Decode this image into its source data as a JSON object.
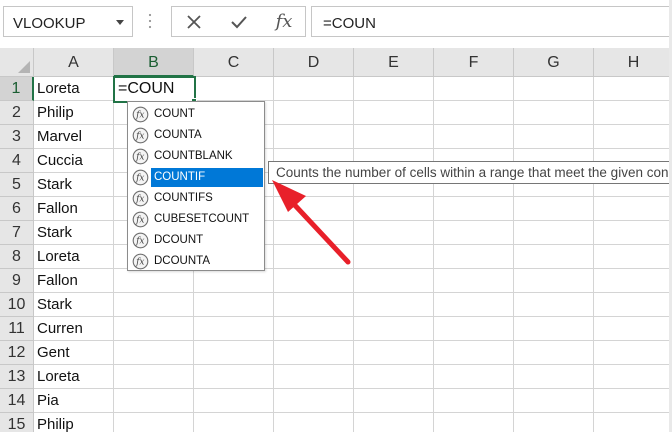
{
  "name_box": {
    "value": "VLOOKUP"
  },
  "formula_bar": {
    "cancel_icon": "x-icon",
    "enter_icon": "check-icon",
    "fx_label": "fx",
    "value": "=COUN"
  },
  "columns": [
    "A",
    "B",
    "C",
    "D",
    "E",
    "F",
    "G",
    "H"
  ],
  "active_column": "B",
  "active_row": "1",
  "rows": [
    {
      "num": "1",
      "a": "Loreta"
    },
    {
      "num": "2",
      "a": "Philip"
    },
    {
      "num": "3",
      "a": "Marvel"
    },
    {
      "num": "4",
      "a": "Cuccia"
    },
    {
      "num": "5",
      "a": "Stark"
    },
    {
      "num": "6",
      "a": "Fallon"
    },
    {
      "num": "7",
      "a": "Stark"
    },
    {
      "num": "8",
      "a": "Loreta"
    },
    {
      "num": "9",
      "a": "Fallon"
    },
    {
      "num": "10",
      "a": "Stark"
    },
    {
      "num": "11",
      "a": "Curren"
    },
    {
      "num": "12",
      "a": "Gent"
    },
    {
      "num": "13",
      "a": "Loreta"
    },
    {
      "num": "14",
      "a": "Pia"
    },
    {
      "num": "15",
      "a": "Philip"
    }
  ],
  "active_cell": {
    "ref": "B1",
    "value": "=COUN"
  },
  "autocomplete": {
    "items": [
      "COUNT",
      "COUNTA",
      "COUNTBLANK",
      "COUNTIF",
      "COUNTIFS",
      "CUBESETCOUNT",
      "DCOUNT",
      "DCOUNTA"
    ],
    "selected": "COUNTIF",
    "tooltip": "Counts the number of cells within a range that meet the given condition"
  },
  "colors": {
    "accent": "#217346",
    "selection": "#0078d7",
    "annotation_arrow": "#e8202a"
  }
}
